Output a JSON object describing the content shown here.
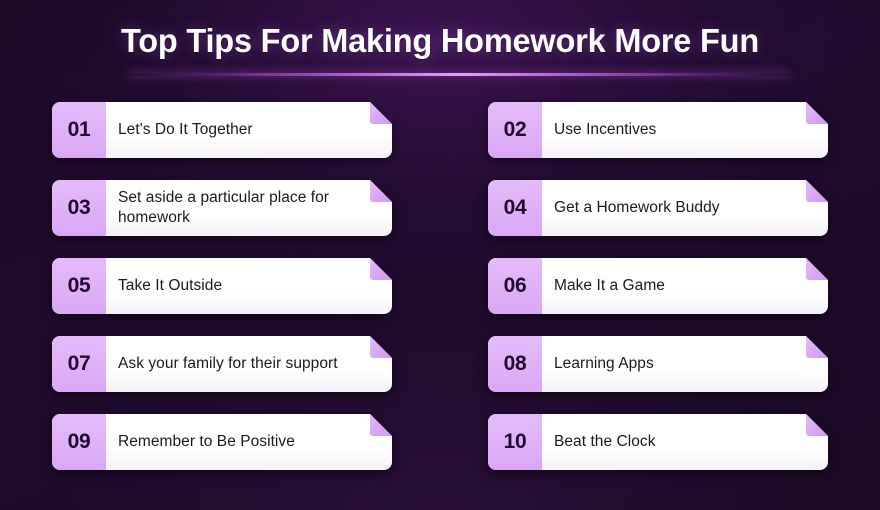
{
  "header": {
    "title": "Top Tips For Making Homework More Fun"
  },
  "colors": {
    "background": "#1c0a26",
    "background_glow": "#401456",
    "divider_accent": "#e4a0fc",
    "number_block": "#dfb0f7",
    "card_body": "#ffffff",
    "number_text": "#200a2e",
    "card_text": "#1b1b1f",
    "title_text": "#ffffff"
  },
  "tips": [
    {
      "number": "01",
      "text": "Let's Do It Together"
    },
    {
      "number": "02",
      "text": "Use Incentives"
    },
    {
      "number": "03",
      "text": "Set aside a particular place for homework"
    },
    {
      "number": "04",
      "text": "Get a Homework Buddy"
    },
    {
      "number": "05",
      "text": "Take It Outside"
    },
    {
      "number": "06",
      "text": "Make It a Game"
    },
    {
      "number": "07",
      "text": "Ask your family for their support"
    },
    {
      "number": "08",
      "text": "Learning Apps"
    },
    {
      "number": "09",
      "text": "Remember to Be Positive"
    },
    {
      "number": "10",
      "text": "Beat the Clock"
    }
  ]
}
